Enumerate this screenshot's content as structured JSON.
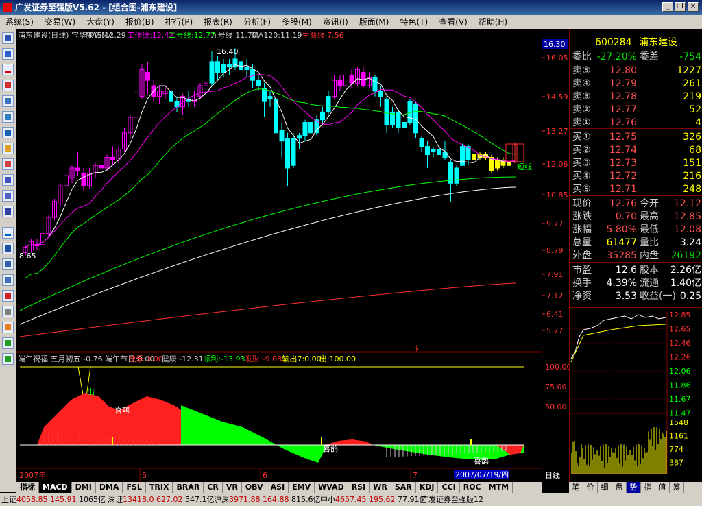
{
  "window": {
    "title": "广发证券至强版V5.62 - [组合图-浦东建设]",
    "min": "_",
    "restore": "❐",
    "close": "✕"
  },
  "menu": [
    "系统(S)",
    "交易(W)",
    "大盘(Y)",
    "报价(B)",
    "排行(P)",
    "报表(R)",
    "分析(F)",
    "多股(M)",
    "资讯(I)",
    "版面(M)",
    "特色(T)",
    "查看(V)",
    "帮助(H)"
  ],
  "kline": {
    "header": [
      {
        "text": "浦东建设(日线) 宝华变色MA",
        "color": "#cccccc"
      },
      {
        "text": "MA5:12.29",
        "color": "#cccccc"
      },
      {
        "text": "工作线:12.42",
        "color": "#ff00ff"
      },
      {
        "text": "二号线:12.77",
        "color": "#00ff00"
      },
      {
        "text": "九号线:11.70",
        "color": "#cccccc"
      },
      {
        "text": "MA120:11.19",
        "color": "#cccccc"
      },
      {
        "text": "生命线:7.56",
        "color": "#ff3030"
      }
    ],
    "high_label": "16.40",
    "low_label": "8.65",
    "short_label": "短线",
    "price_ticks": [
      "16.05",
      "14.59",
      "13.27",
      "12.06",
      "10.85",
      "9.77",
      "8.79",
      "7.91",
      "7.12",
      "6.41",
      "5.77"
    ],
    "top_label": "16.30"
  },
  "indicator": {
    "header": [
      {
        "text": "端午祝福 五月初五:-0.76 端午节日:0.00",
        "color": "#cccccc"
      },
      {
        "text": "快乐:0.00",
        "color": "#ff3030"
      },
      {
        "text": "健康:-12.31",
        "color": "#cccccc"
      },
      {
        "text": "顺利:-13.93",
        "color": "#00ff00"
      },
      {
        "text": "发财:-9.08",
        "color": "#ff3030"
      },
      {
        "text": "输出7:0.00",
        "color": "#ffff00"
      },
      {
        "text": "出:100.00",
        "color": "#ffff00"
      }
    ],
    "ticks": [
      "100.00",
      "75.00",
      "50.00"
    ],
    "labels": {
      "out": "出",
      "xique1": "喜鹊",
      "xique2": "喜鹊",
      "xique3": "喜鹊",
      "dollar": "$"
    }
  },
  "time_axis": {
    "year": "2007年",
    "m5": "5",
    "m6": "6",
    "m7": "7",
    "current": "2007/07/19/四",
    "period": "日线"
  },
  "quote": {
    "code": "600284",
    "name": "浦东建设",
    "weibi_label": "委比",
    "weibi": "-27.20%",
    "weicha_label": "委差",
    "weicha": "-754",
    "sells": [
      {
        "l": "卖⑤",
        "p": "12.80",
        "v": "1227"
      },
      {
        "l": "卖④",
        "p": "12.79",
        "v": "261"
      },
      {
        "l": "卖③",
        "p": "12.78",
        "v": "219"
      },
      {
        "l": "卖②",
        "p": "12.77",
        "v": "52"
      },
      {
        "l": "卖①",
        "p": "12.76",
        "v": "4"
      }
    ],
    "buys": [
      {
        "l": "买①",
        "p": "12.75",
        "v": "326"
      },
      {
        "l": "买②",
        "p": "12.74",
        "v": "68"
      },
      {
        "l": "买③",
        "p": "12.73",
        "v": "151"
      },
      {
        "l": "买④",
        "p": "12.72",
        "v": "216"
      },
      {
        "l": "买⑤",
        "p": "12.71",
        "v": "248"
      }
    ],
    "stats": [
      {
        "l": "现价",
        "v": "12.76",
        "vc": "red",
        "l2": "今开",
        "v2": "12.12",
        "v2c": "red"
      },
      {
        "l": "涨跌",
        "v": "0.70",
        "vc": "red",
        "l2": "最高",
        "v2": "12.85",
        "v2c": "red"
      },
      {
        "l": "涨幅",
        "v": "5.80%",
        "vc": "red",
        "l2": "最低",
        "v2": "12.08",
        "v2c": "red"
      },
      {
        "l": "总量",
        "v": "61477",
        "vc": "yel",
        "l2": "量比",
        "v2": "3.24",
        "v2c": "wht"
      },
      {
        "l": "外盘",
        "v": "35285",
        "vc": "red",
        "l2": "内盘",
        "v2": "26192",
        "v2c": "grn"
      }
    ],
    "stats2": [
      {
        "l": "市盈",
        "v": "12.6",
        "l2": "股本",
        "v2": "2.26亿"
      },
      {
        "l": "换手",
        "v": "4.39%",
        "l2": "流通",
        "v2": "1.40亿"
      },
      {
        "l": "净资",
        "v": "3.53",
        "l2": "收益(一)",
        "v2": "0.25"
      }
    ],
    "mini_ticks": [
      "12.85",
      "12.65",
      "12.46",
      "12.26",
      "12.06",
      "11.86",
      "11.67",
      "11.47"
    ],
    "vol_ticks": [
      "1548",
      "1161",
      "774",
      "387"
    ]
  },
  "tabs": [
    "指标",
    "MACD",
    "DMI",
    "DMA",
    "FSL",
    "TRIX",
    "BRAR",
    "CR",
    "VR",
    "OBV",
    "ASI",
    "EMV",
    "WVAD",
    "RSI",
    "WR",
    "SAR",
    "KDJ",
    "CCI",
    "ROC",
    "MTM"
  ],
  "qtabs": [
    "笔",
    "价",
    "细",
    "盘",
    "势",
    "指",
    "值",
    "筹"
  ],
  "status": [
    {
      "label": "上证",
      "a": "4058.85",
      "b": "145.91",
      "c": "1065亿"
    },
    {
      "label": "深证",
      "a": "13418.0",
      "b": "627.02",
      "c": "547.1亿"
    },
    {
      "label": "沪深",
      "a": "3971.88",
      "b": "164.88",
      "c": "815.6亿"
    },
    {
      "label": "中小",
      "a": "4657.45",
      "b": "195.62",
      "c": "77.91亿"
    },
    {
      "label": "广发证券至强版12",
      "a": "",
      "b": "",
      "c": ""
    }
  ],
  "colors": {
    "up": "#ff3030",
    "down": "#00ffff",
    "magenta": "#ff00ff",
    "yellow": "#ffff00",
    "green": "#00ff00",
    "axis": "#800000"
  }
}
